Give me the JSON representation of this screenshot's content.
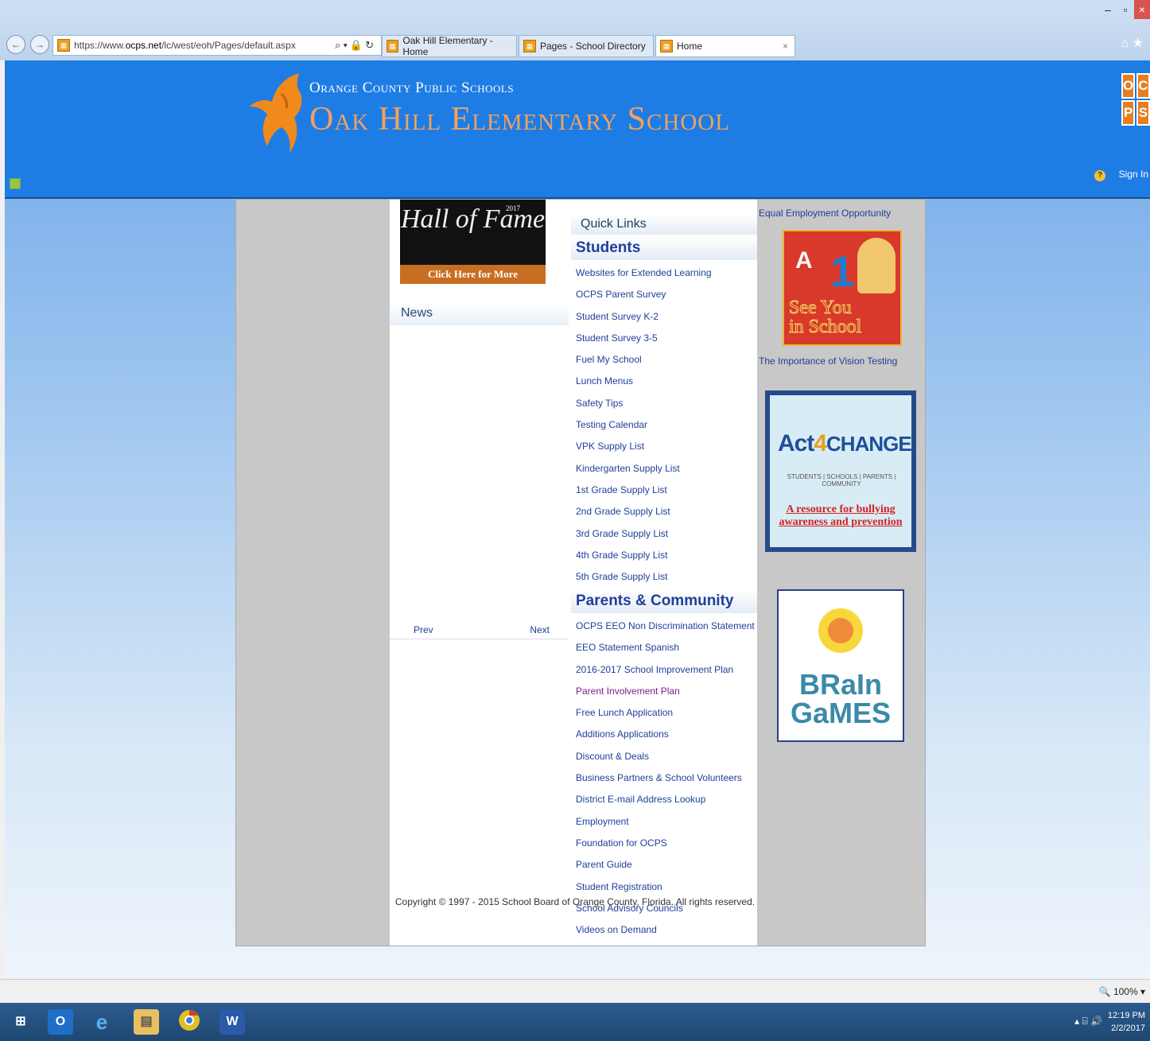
{
  "browser": {
    "url_prefix": "https://www.",
    "url_domain": "ocps.net",
    "url_path": "/lc/west/eoh/Pages/default.aspx",
    "tabs": [
      {
        "label": "Oak Hill Elementary - Home"
      },
      {
        "label": "Pages - School Directory"
      },
      {
        "label": "Home",
        "close": "×"
      }
    ]
  },
  "header": {
    "org_name": "Orange County Public Schools",
    "school_name": "Oak Hill Elementary School",
    "ocps_letters": [
      "O",
      "C",
      "P",
      "S"
    ],
    "help_label": "?",
    "sign_in": "Sign In"
  },
  "hall_of_fame": {
    "title": "Hall of Fame",
    "year": "2017",
    "cta": "Click Here for More Information"
  },
  "news": {
    "heading": "News",
    "prev": "Prev",
    "next": "Next"
  },
  "quick_links": {
    "heading": "Quick Links",
    "students_heading": "Students",
    "students": [
      "Websites for Extended Learning",
      "OCPS Parent Survey",
      "Student Survey K-2",
      "Student Survey 3-5",
      "Fuel My School",
      "Lunch Menus",
      "Safety Tips",
      "Testing Calendar",
      "VPK Supply List",
      "Kindergarten Supply List",
      "1st Grade Supply List",
      "2nd Grade Supply List",
      "3rd Grade Supply List",
      "4th Grade Supply List",
      "5th Grade Supply List"
    ],
    "parents_heading": "Parents & Community",
    "parents": [
      "OCPS EEO Non Discrimination Statement",
      "EEO Statement Spanish",
      "2016-2017 School Improvement Plan",
      "Parent Involvement Plan",
      "Free Lunch Application",
      "Additions Applications",
      "Discount & Deals",
      "Business Partners & School Volunteers",
      "District E-mail Address Lookup",
      "Employment",
      "Foundation for OCPS",
      "Parent Guide",
      "Student Registration",
      "School Advisory Councils",
      "Videos on Demand"
    ]
  },
  "right_column": {
    "eeo_link": "Equal Employment Opportunity",
    "see_you": {
      "line1": "See You",
      "line2": "in School",
      "letters": "A",
      "number": "1"
    },
    "vision_link": "The Importance of Vision Testing",
    "act4change": {
      "logo_a": "Act",
      "logo_4": "4",
      "logo_b": "CHANGE",
      "subtitle": "STUDENTS | SCHOOLS | PARENTS | COMMUNITY",
      "resource": "A resource for bullying awareness and prevention"
    },
    "brain_games": {
      "line1": "BRaIn",
      "line2": "GaMES"
    }
  },
  "footer": {
    "copyright": "Copyright © 1997 - 2015 School Board of Orange County, Florida. All rights reserved."
  },
  "status": {
    "zoom": "100%"
  },
  "taskbar": {
    "time": "12:19 PM",
    "date": "2/2/2017"
  },
  "colors": {
    "header_blue": "#1e7de4",
    "school_name_orange": "#f4a15c",
    "link_blue": "#1f3f9a",
    "visited_purple": "#7a1f8c"
  }
}
